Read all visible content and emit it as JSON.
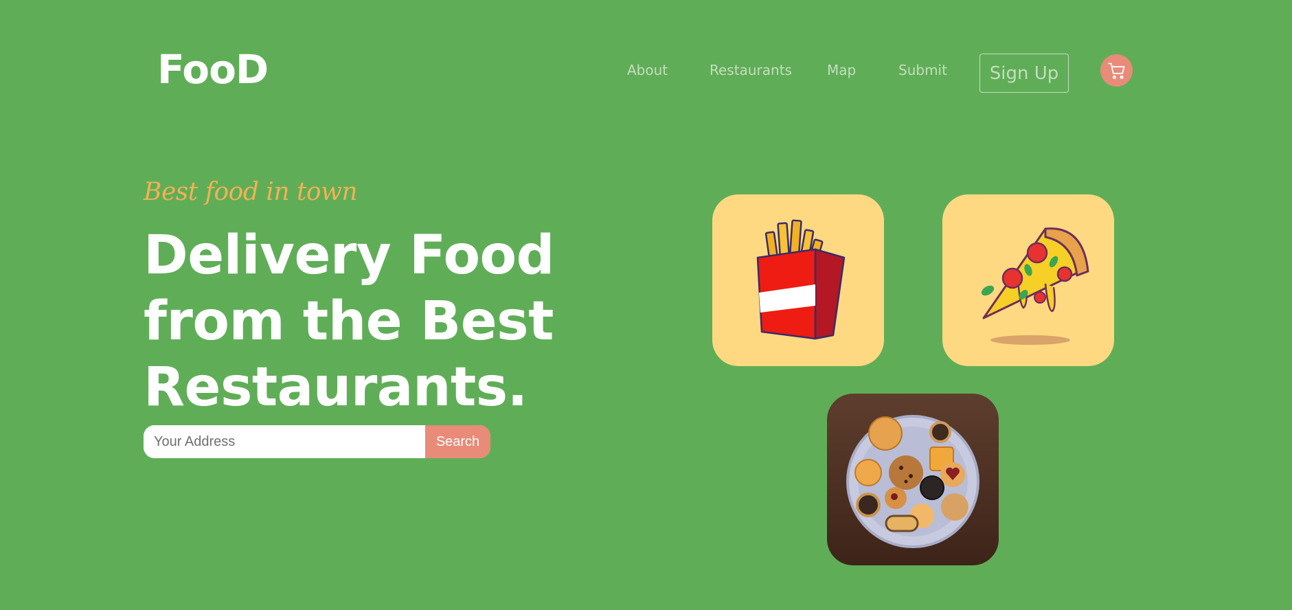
{
  "header": {
    "logo": "FooD",
    "nav": [
      {
        "label": "About"
      },
      {
        "label": "Restaurants"
      },
      {
        "label": "Map"
      },
      {
        "label": "Submit"
      }
    ],
    "signup_label": "Sign Up",
    "cart_icon": "cart-icon"
  },
  "hero": {
    "tagline": "Best food in town",
    "headline_lines": [
      "Delivery Food",
      "from the Best",
      "Restaurants."
    ],
    "search": {
      "placeholder": "Your Address",
      "value": "",
      "button_label": "Search"
    }
  },
  "cards": [
    {
      "icon": "fries-icon"
    },
    {
      "icon": "pizza-slice-icon"
    },
    {
      "icon": "cookies-plate-icon"
    }
  ],
  "colors": {
    "background": "#5fae57",
    "accent": "#e88b78",
    "card_yellow": "#ffd982",
    "tagline": "#f2b155"
  }
}
